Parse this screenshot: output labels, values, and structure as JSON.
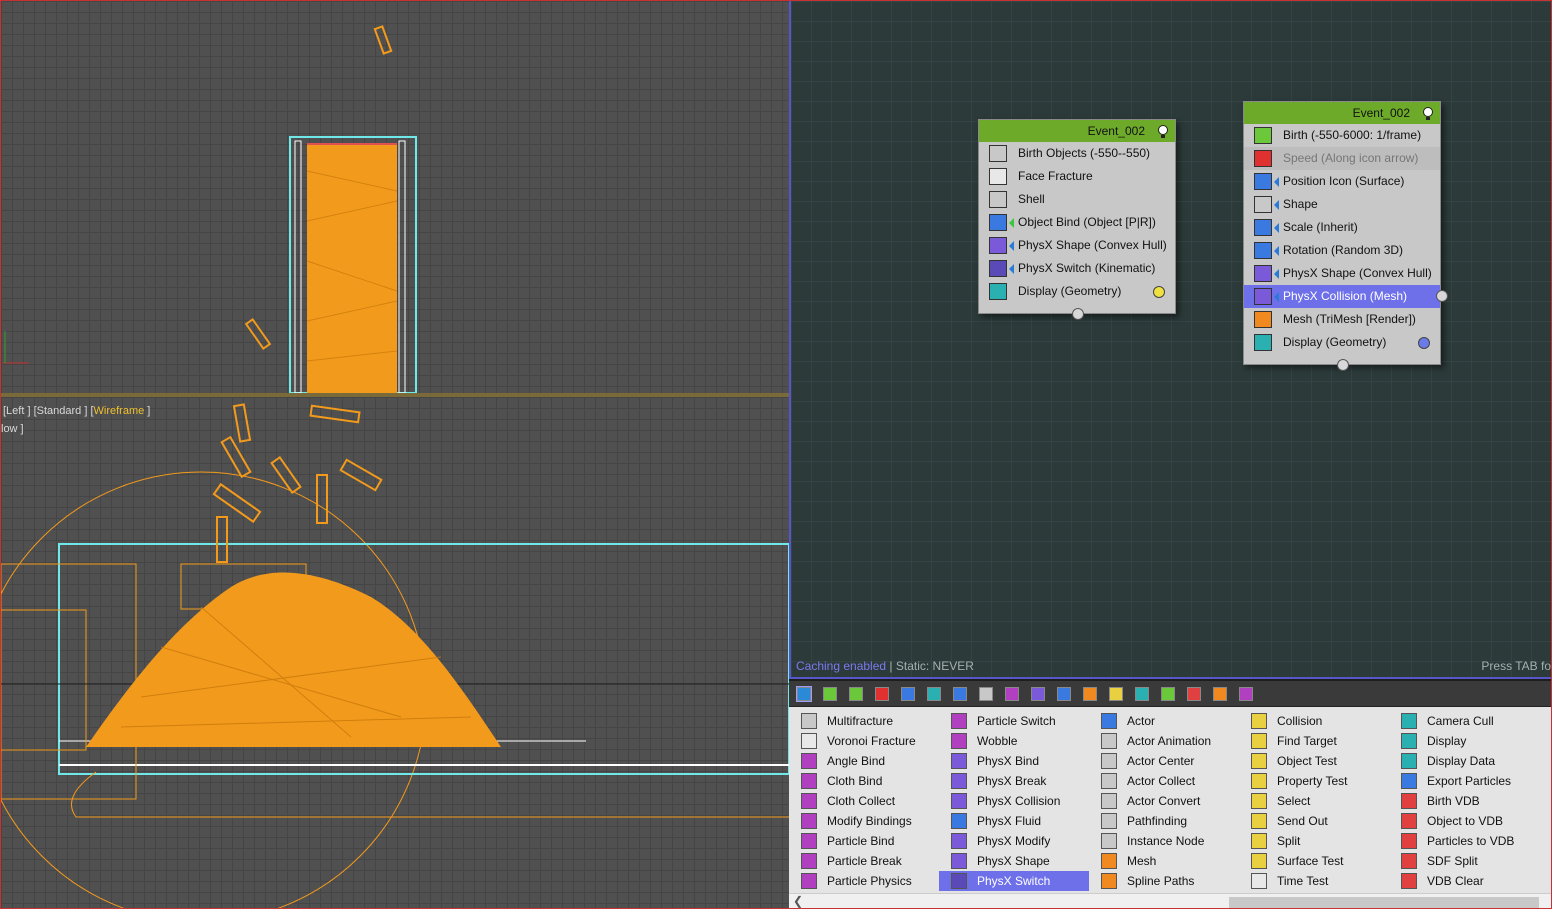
{
  "viewport_top": {
    "name": "top-viewport"
  },
  "viewport_left": {
    "label_prefix": "[Left ] [Standard ] [",
    "label_mode": "Wireframe",
    "label_suffix": " ]",
    "sublabel": "low ]"
  },
  "particle_view": {
    "status_enabled": "Caching enabled",
    "status_sep": " | ",
    "status_static": "Static: NEVER",
    "hint": "Press TAB fo",
    "nodes": [
      {
        "title": "Event_002",
        "operators": [
          {
            "label": "Birth Objects (-550--550)",
            "icon_color": "#c8c8c8",
            "state": "normal"
          },
          {
            "label": "Face Fracture",
            "icon_color": "#e8e8e8",
            "state": "normal"
          },
          {
            "label": "Shell",
            "icon_color": "#c8c8c8",
            "state": "normal"
          },
          {
            "label": "Object Bind (Object [P|R])",
            "icon_color": "#3a7ae0",
            "state": "normal"
          },
          {
            "label": "PhysX Shape (Convex Hull)",
            "icon_color": "#7a5ad8",
            "state": "normal"
          },
          {
            "label": "PhysX Switch (Kinematic)",
            "icon_color": "#5a4ab8",
            "state": "normal"
          },
          {
            "label": "Display (Geometry)",
            "icon_color": "#2ab0b0",
            "state": "normal",
            "dot_color": "#f0e040"
          }
        ]
      },
      {
        "title": "Event_002",
        "operators": [
          {
            "label": "Birth (-550-6000: 1/frame)",
            "icon_color": "#6ac83a",
            "state": "normal"
          },
          {
            "label": "Speed (Along icon arrow)",
            "icon_color": "#e03030",
            "state": "disabled"
          },
          {
            "label": "Position Icon (Surface)",
            "icon_color": "#3a7ae0",
            "state": "normal"
          },
          {
            "label": "Shape",
            "icon_color": "#c8c8c8",
            "state": "normal"
          },
          {
            "label": "Scale (Inherit)",
            "icon_color": "#3a7ae0",
            "state": "normal"
          },
          {
            "label": "Rotation (Random 3D)",
            "icon_color": "#3a7ae0",
            "state": "normal"
          },
          {
            "label": "PhysX Shape (Convex Hull)",
            "icon_color": "#7a5ad8",
            "state": "normal"
          },
          {
            "label": "PhysX Collision (Mesh)",
            "icon_color": "#7a5ad8",
            "state": "selected"
          },
          {
            "label": "Mesh (TriMesh [Render])",
            "icon_color": "#f08a20",
            "state": "normal"
          },
          {
            "label": "Display (Geometry)",
            "icon_color": "#2ab0b0",
            "state": "normal",
            "dot_color": "#6a7ae8"
          }
        ]
      }
    ]
  },
  "depot": {
    "toolbar_icons": [
      "all-icon",
      "birth-icon",
      "grid-icon",
      "delete-icon",
      "position-icon",
      "shape-icon",
      "speed-icon",
      "bind-icon",
      "physx-icon",
      "fracture-icon",
      "actor-icon",
      "mesh-icon",
      "test-icon",
      "display-icon",
      "send-icon",
      "vdb-icon",
      "paint-icon",
      "misc-icon"
    ],
    "toolbar_colors": [
      "#2a8ad8",
      "#6ac83a",
      "#6ac83a",
      "#e03030",
      "#3a7ae0",
      "#2ab0b0",
      "#3a7ae0",
      "#c8c8c8",
      "#b040c0",
      "#7a5ad8",
      "#3a7ae0",
      "#f08a20",
      "#e8d040",
      "#2ab0b0",
      "#6ac83a",
      "#e04040",
      "#f08a20",
      "#b040c0"
    ],
    "columns": [
      {
        "items": [
          {
            "label": "Multifracture",
            "color": "#c8c8c8"
          },
          {
            "label": "Voronoi Fracture",
            "color": "#e8e8e8"
          },
          {
            "label": "Angle Bind",
            "color": "#b040c0"
          },
          {
            "label": "Cloth Bind",
            "color": "#b040c0"
          },
          {
            "label": "Cloth Collect",
            "color": "#b040c0"
          },
          {
            "label": "Modify Bindings",
            "color": "#b040c0"
          },
          {
            "label": "Particle Bind",
            "color": "#b040c0"
          },
          {
            "label": "Particle Break",
            "color": "#b040c0"
          },
          {
            "label": "Particle Physics",
            "color": "#b040c0"
          }
        ]
      },
      {
        "items": [
          {
            "label": "Particle Switch",
            "color": "#b040c0"
          },
          {
            "label": "Wobble",
            "color": "#b040c0"
          },
          {
            "label": "PhysX Bind",
            "color": "#7a5ad8"
          },
          {
            "label": "PhysX Break",
            "color": "#7a5ad8"
          },
          {
            "label": "PhysX Collision",
            "color": "#7a5ad8"
          },
          {
            "label": "PhysX Fluid",
            "color": "#3a7ae0"
          },
          {
            "label": "PhysX Modify",
            "color": "#7a5ad8"
          },
          {
            "label": "PhysX Shape",
            "color": "#7a5ad8"
          },
          {
            "label": "PhysX Switch",
            "color": "#5a4ab8",
            "selected": true
          }
        ]
      },
      {
        "items": [
          {
            "label": "Actor",
            "color": "#3a7ae0"
          },
          {
            "label": "Actor Animation",
            "color": "#c8c8c8"
          },
          {
            "label": "Actor Center",
            "color": "#c8c8c8"
          },
          {
            "label": "Actor Collect",
            "color": "#c8c8c8"
          },
          {
            "label": "Actor Convert",
            "color": "#c8c8c8"
          },
          {
            "label": "Pathfinding",
            "color": "#c8c8c8"
          },
          {
            "label": "Instance Node",
            "color": "#c8c8c8"
          },
          {
            "label": "Mesh",
            "color": "#f08a20"
          },
          {
            "label": "Spline Paths",
            "color": "#f08a20"
          }
        ]
      },
      {
        "items": [
          {
            "label": "Collision",
            "color": "#e8d040"
          },
          {
            "label": "Find Target",
            "color": "#e8d040"
          },
          {
            "label": "Object Test",
            "color": "#e8d040"
          },
          {
            "label": "Property Test",
            "color": "#e8d040"
          },
          {
            "label": "Select",
            "color": "#e8d040"
          },
          {
            "label": "Send Out",
            "color": "#e8d040"
          },
          {
            "label": "Split",
            "color": "#e8d040"
          },
          {
            "label": "Surface Test",
            "color": "#e8d040"
          },
          {
            "label": "Time Test",
            "color": "#e8e8e8"
          }
        ]
      },
      {
        "items": [
          {
            "label": "Camera Cull",
            "color": "#2ab0b0"
          },
          {
            "label": "Display",
            "color": "#2ab0b0"
          },
          {
            "label": "Display Data",
            "color": "#2ab0b0"
          },
          {
            "label": "Export Particles",
            "color": "#3a7ae0"
          },
          {
            "label": "Birth VDB",
            "color": "#e04040"
          },
          {
            "label": "Object to VDB",
            "color": "#e04040"
          },
          {
            "label": "Particles to VDB",
            "color": "#e04040"
          },
          {
            "label": "SDF Split",
            "color": "#e04040"
          },
          {
            "label": "VDB Clear",
            "color": "#e04040"
          }
        ]
      }
    ]
  }
}
